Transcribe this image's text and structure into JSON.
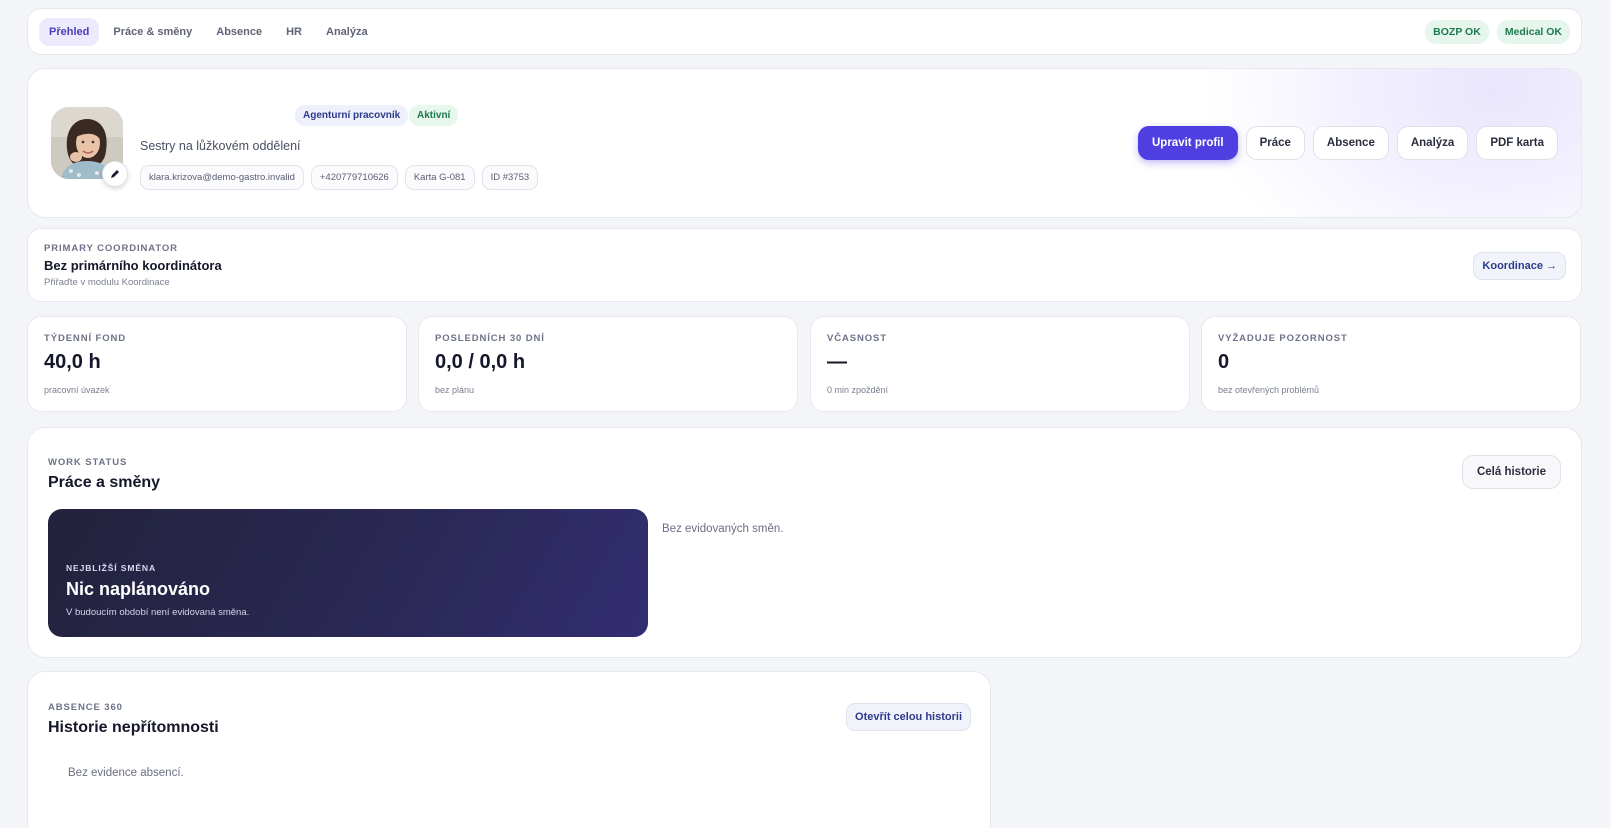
{
  "nav": {
    "tabs": [
      {
        "label": "Přehled",
        "active": true
      },
      {
        "label": "Práce & směny",
        "active": false
      },
      {
        "label": "Absence",
        "active": false
      },
      {
        "label": "HR",
        "active": false
      },
      {
        "label": "Analýza",
        "active": false
      }
    ],
    "status_pills": [
      "BOZP OK",
      "Medical OK"
    ]
  },
  "profile": {
    "badges": {
      "type": "Agenturní pracovník",
      "status": "Aktivní"
    },
    "role": "Sestry na lůžkovém oddělení",
    "chips": [
      "klara.krizova@demo-gastro.invalid",
      "+420779710626",
      "Karta G-081",
      "ID #3753"
    ],
    "edit_icon": "pencil-icon",
    "actions": {
      "edit": "Upravit profil",
      "work": "Práce",
      "absence": "Absence",
      "analysis": "Analýza",
      "pdf": "PDF karta"
    }
  },
  "coordinator": {
    "eyebrow": "PRIMARY COORDINATOR",
    "title": "Bez primárního koordinátora",
    "sub": "Přiřaďte v modulu Koordinace",
    "button": "Koordinace →"
  },
  "stats": [
    {
      "eyebrow": "TÝDENNÍ FOND",
      "value": "40,0 h",
      "caption": "pracovní úvazek"
    },
    {
      "eyebrow": "POSLEDNÍCH 30 DNÍ",
      "value": "0,0 / 0,0 h",
      "caption": "bez plánu"
    },
    {
      "eyebrow": "VČASNOST",
      "value": "—",
      "caption": "0 min zpoždění"
    },
    {
      "eyebrow": "VYŽADUJE POZORNOST",
      "value": "0",
      "caption": "bez otevřených problémů"
    }
  ],
  "work": {
    "eyebrow": "WORK STATUS",
    "title": "Práce a směny",
    "button": "Celá historie",
    "next_shift": {
      "eyebrow": "NEJBLIŽŠÍ SMĚNA",
      "title": "Nic naplánováno",
      "sub": "V budoucím období není evidovaná směna."
    },
    "empty": "Bez evidovaných směn."
  },
  "absence": {
    "eyebrow": "ABSENCE 360",
    "title": "Historie nepřítomnosti",
    "button": "Otevřít celou historii",
    "empty": "Bez evidence absencí."
  },
  "colors": {
    "primary": "#4f3fe0",
    "ok_green": "#1c7a4e",
    "shift_dark": "#22223c"
  }
}
